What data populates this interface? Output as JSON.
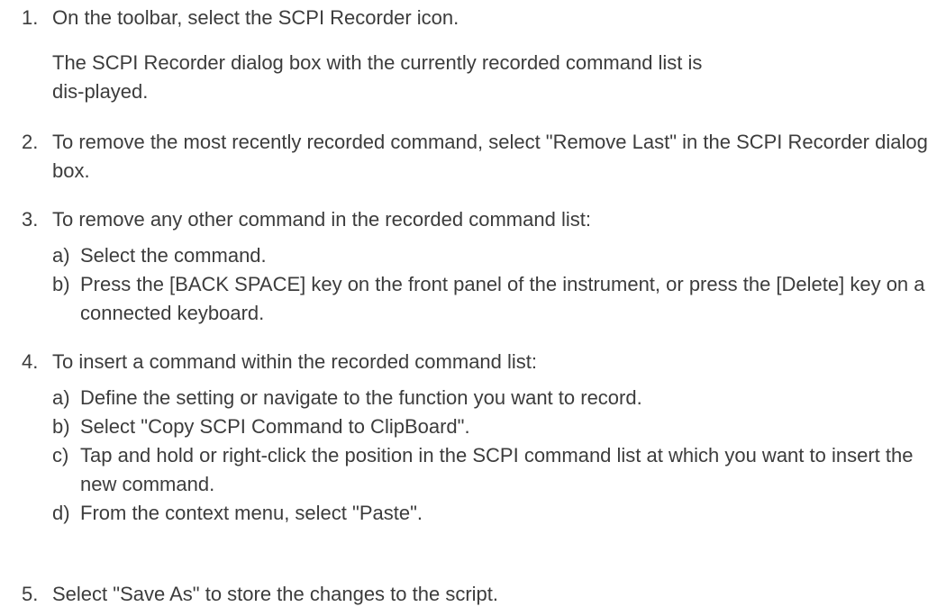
{
  "steps": [
    {
      "num": "1.",
      "text": "On the toolbar, select the SCPI Recorder icon.",
      "result": "The SCPI Recorder dialog box with the currently recorded command list is dis-played."
    },
    {
      "num": "2.",
      "text": "To remove the most recently recorded command, select \"Remove Last\" in the SCPI Recorder dialog box."
    },
    {
      "num": "3.",
      "text": "To remove any other command in the recorded command list:",
      "substeps": [
        {
          "letter": "a)",
          "text": "Select the command."
        },
        {
          "letter": "b)",
          "text": "Press the [BACK SPACE] key on the front panel of the instrument, or press the [Delete] key on a connected keyboard."
        }
      ]
    },
    {
      "num": "4.",
      "text": "To insert a command within the recorded command list:",
      "substeps": [
        {
          "letter": "a)",
          "text": "Define the setting or navigate to the function you want to record."
        },
        {
          "letter": "b)",
          "text": "Select \"Copy SCPI Command to ClipBoard\"."
        },
        {
          "letter": "c)",
          "text": "Tap and hold or right-click the position in the SCPI command list at which you want to insert the new command."
        },
        {
          "letter": "d)",
          "text": "From the context menu, select \"Paste\"."
        }
      ]
    },
    {
      "num": "5.",
      "text": "Select \"Save As\" to store the changes to the script."
    }
  ]
}
